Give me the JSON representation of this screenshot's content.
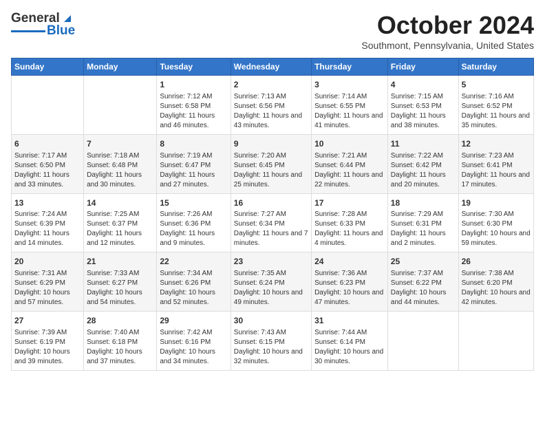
{
  "header": {
    "logo_line1": "General",
    "logo_line2": "Blue",
    "month": "October 2024",
    "location": "Southmont, Pennsylvania, United States"
  },
  "days_of_week": [
    "Sunday",
    "Monday",
    "Tuesday",
    "Wednesday",
    "Thursday",
    "Friday",
    "Saturday"
  ],
  "weeks": [
    [
      {
        "day": "",
        "info": ""
      },
      {
        "day": "",
        "info": ""
      },
      {
        "day": "1",
        "info": "Sunrise: 7:12 AM\nSunset: 6:58 PM\nDaylight: 11 hours and 46 minutes."
      },
      {
        "day": "2",
        "info": "Sunrise: 7:13 AM\nSunset: 6:56 PM\nDaylight: 11 hours and 43 minutes."
      },
      {
        "day": "3",
        "info": "Sunrise: 7:14 AM\nSunset: 6:55 PM\nDaylight: 11 hours and 41 minutes."
      },
      {
        "day": "4",
        "info": "Sunrise: 7:15 AM\nSunset: 6:53 PM\nDaylight: 11 hours and 38 minutes."
      },
      {
        "day": "5",
        "info": "Sunrise: 7:16 AM\nSunset: 6:52 PM\nDaylight: 11 hours and 35 minutes."
      }
    ],
    [
      {
        "day": "6",
        "info": "Sunrise: 7:17 AM\nSunset: 6:50 PM\nDaylight: 11 hours and 33 minutes."
      },
      {
        "day": "7",
        "info": "Sunrise: 7:18 AM\nSunset: 6:48 PM\nDaylight: 11 hours and 30 minutes."
      },
      {
        "day": "8",
        "info": "Sunrise: 7:19 AM\nSunset: 6:47 PM\nDaylight: 11 hours and 27 minutes."
      },
      {
        "day": "9",
        "info": "Sunrise: 7:20 AM\nSunset: 6:45 PM\nDaylight: 11 hours and 25 minutes."
      },
      {
        "day": "10",
        "info": "Sunrise: 7:21 AM\nSunset: 6:44 PM\nDaylight: 11 hours and 22 minutes."
      },
      {
        "day": "11",
        "info": "Sunrise: 7:22 AM\nSunset: 6:42 PM\nDaylight: 11 hours and 20 minutes."
      },
      {
        "day": "12",
        "info": "Sunrise: 7:23 AM\nSunset: 6:41 PM\nDaylight: 11 hours and 17 minutes."
      }
    ],
    [
      {
        "day": "13",
        "info": "Sunrise: 7:24 AM\nSunset: 6:39 PM\nDaylight: 11 hours and 14 minutes."
      },
      {
        "day": "14",
        "info": "Sunrise: 7:25 AM\nSunset: 6:37 PM\nDaylight: 11 hours and 12 minutes."
      },
      {
        "day": "15",
        "info": "Sunrise: 7:26 AM\nSunset: 6:36 PM\nDaylight: 11 hours and 9 minutes."
      },
      {
        "day": "16",
        "info": "Sunrise: 7:27 AM\nSunset: 6:34 PM\nDaylight: 11 hours and 7 minutes."
      },
      {
        "day": "17",
        "info": "Sunrise: 7:28 AM\nSunset: 6:33 PM\nDaylight: 11 hours and 4 minutes."
      },
      {
        "day": "18",
        "info": "Sunrise: 7:29 AM\nSunset: 6:31 PM\nDaylight: 11 hours and 2 minutes."
      },
      {
        "day": "19",
        "info": "Sunrise: 7:30 AM\nSunset: 6:30 PM\nDaylight: 10 hours and 59 minutes."
      }
    ],
    [
      {
        "day": "20",
        "info": "Sunrise: 7:31 AM\nSunset: 6:29 PM\nDaylight: 10 hours and 57 minutes."
      },
      {
        "day": "21",
        "info": "Sunrise: 7:33 AM\nSunset: 6:27 PM\nDaylight: 10 hours and 54 minutes."
      },
      {
        "day": "22",
        "info": "Sunrise: 7:34 AM\nSunset: 6:26 PM\nDaylight: 10 hours and 52 minutes."
      },
      {
        "day": "23",
        "info": "Sunrise: 7:35 AM\nSunset: 6:24 PM\nDaylight: 10 hours and 49 minutes."
      },
      {
        "day": "24",
        "info": "Sunrise: 7:36 AM\nSunset: 6:23 PM\nDaylight: 10 hours and 47 minutes."
      },
      {
        "day": "25",
        "info": "Sunrise: 7:37 AM\nSunset: 6:22 PM\nDaylight: 10 hours and 44 minutes."
      },
      {
        "day": "26",
        "info": "Sunrise: 7:38 AM\nSunset: 6:20 PM\nDaylight: 10 hours and 42 minutes."
      }
    ],
    [
      {
        "day": "27",
        "info": "Sunrise: 7:39 AM\nSunset: 6:19 PM\nDaylight: 10 hours and 39 minutes."
      },
      {
        "day": "28",
        "info": "Sunrise: 7:40 AM\nSunset: 6:18 PM\nDaylight: 10 hours and 37 minutes."
      },
      {
        "day": "29",
        "info": "Sunrise: 7:42 AM\nSunset: 6:16 PM\nDaylight: 10 hours and 34 minutes."
      },
      {
        "day": "30",
        "info": "Sunrise: 7:43 AM\nSunset: 6:15 PM\nDaylight: 10 hours and 32 minutes."
      },
      {
        "day": "31",
        "info": "Sunrise: 7:44 AM\nSunset: 6:14 PM\nDaylight: 10 hours and 30 minutes."
      },
      {
        "day": "",
        "info": ""
      },
      {
        "day": "",
        "info": ""
      }
    ]
  ]
}
